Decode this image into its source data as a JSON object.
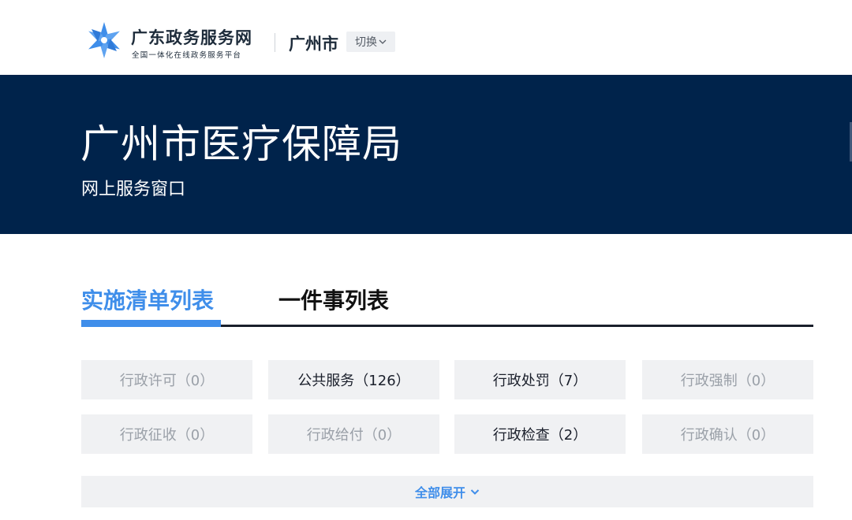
{
  "header": {
    "brand_name": "广东政务服务网",
    "brand_sub": "全国一体化在线政务服务平台",
    "city": "广州市",
    "switch_label": "切换",
    "logo_color": "#3f8eea"
  },
  "banner": {
    "title": "广州市医疗保障局",
    "subtitle": "网上服务窗口",
    "background": "#00234b"
  },
  "tabs": [
    {
      "label": "实施清单列表",
      "active": true
    },
    {
      "label": "一件事列表",
      "active": false
    }
  ],
  "categories": [
    {
      "label": "行政许可（0）",
      "enabled": false
    },
    {
      "label": "公共服务（126）",
      "enabled": true
    },
    {
      "label": "行政处罚（7）",
      "enabled": true
    },
    {
      "label": "行政强制（0）",
      "enabled": false
    },
    {
      "label": "行政征收（0）",
      "enabled": false
    },
    {
      "label": "行政给付（0）",
      "enabled": false
    },
    {
      "label": "行政检查（2）",
      "enabled": true
    },
    {
      "label": "行政确认（0）",
      "enabled": false
    }
  ],
  "expand_all": {
    "label": "全部展开",
    "icon": "chevron-down-icon"
  },
  "colors": {
    "accent": "#3f8eea",
    "tab_underline": "#1a1f2b",
    "cell_bg": "#f0f1f3",
    "disabled_text": "#9aa0a8"
  }
}
